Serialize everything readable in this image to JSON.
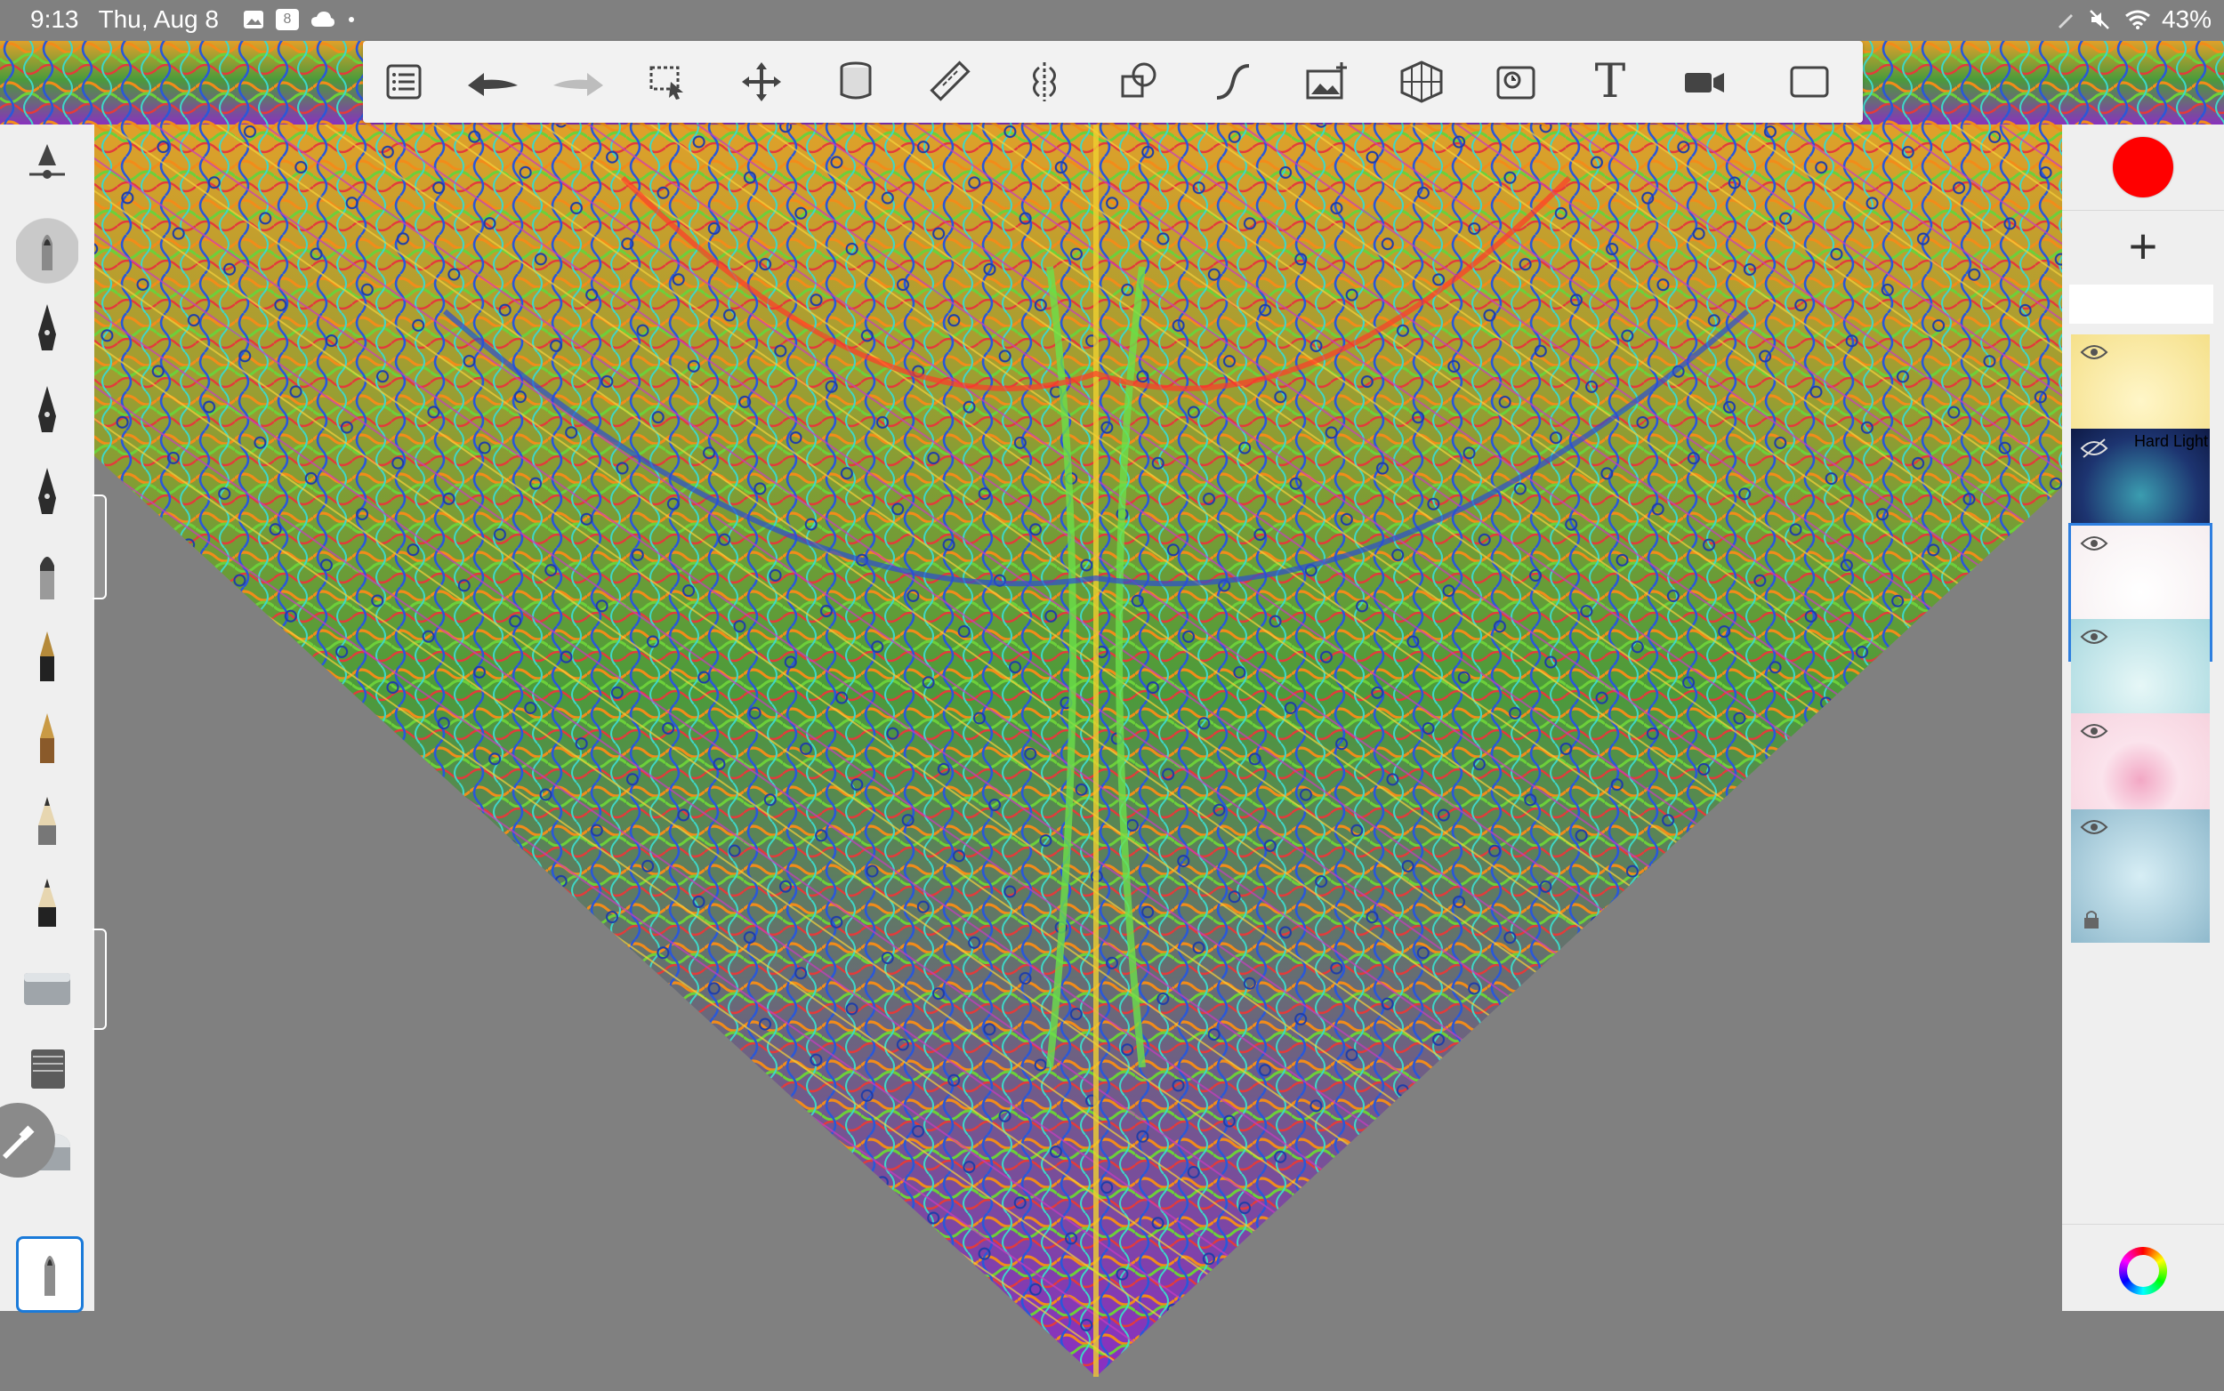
{
  "status_bar": {
    "time": "9:13",
    "date": "Thu, Aug 8",
    "calendar_day": "8",
    "battery": "43%",
    "left_icons": [
      "gallery-icon",
      "calendar-icon",
      "cloud-icon",
      "dot-icon"
    ],
    "right_icons": [
      "pen-icon",
      "mute-icon",
      "wifi-icon",
      "battery-icon"
    ]
  },
  "toolbar": {
    "tools": [
      {
        "name": "layers-list-button",
        "icon": "list-icon"
      },
      {
        "name": "undo-button",
        "icon": "undo-arrow-icon"
      },
      {
        "name": "redo-button",
        "icon": "redo-arrow-icon"
      },
      {
        "name": "selection-button",
        "icon": "selection-icon"
      },
      {
        "name": "transform-button",
        "icon": "move-icon"
      },
      {
        "name": "fill-button",
        "icon": "fill-bucket-icon"
      },
      {
        "name": "ruler-button",
        "icon": "ruler-icon"
      },
      {
        "name": "symmetry-button",
        "icon": "symmetry-icon"
      },
      {
        "name": "shapes-button",
        "icon": "shapes-icon"
      },
      {
        "name": "curve-button",
        "icon": "curve-icon"
      },
      {
        "name": "import-image-button",
        "icon": "image-add-icon"
      },
      {
        "name": "perspective-button",
        "icon": "perspective-grid-icon"
      },
      {
        "name": "timelapse-button",
        "icon": "timelapse-icon"
      },
      {
        "name": "text-button",
        "icon": "text-icon",
        "label": "T"
      },
      {
        "name": "record-button",
        "icon": "video-icon"
      },
      {
        "name": "fullscreen-button",
        "icon": "fullscreen-icon"
      }
    ]
  },
  "brushes": [
    {
      "name": "brush-settings",
      "icon": "brush-settings-icon"
    },
    {
      "name": "airbrush",
      "icon": "airbrush-icon"
    },
    {
      "name": "fine-pen",
      "icon": "pen-nib-icon"
    },
    {
      "name": "pen",
      "icon": "pen-nib-icon"
    },
    {
      "name": "ink-pen",
      "icon": "pen-nib-icon"
    },
    {
      "name": "marker",
      "icon": "marker-icon"
    },
    {
      "name": "fountain-pen",
      "icon": "fountain-pen-icon"
    },
    {
      "name": "calligraphy-pen",
      "icon": "calligraphy-pen-icon"
    },
    {
      "name": "pencil",
      "icon": "pencil-icon"
    },
    {
      "name": "graphite-pencil",
      "icon": "pencil-icon"
    },
    {
      "name": "eraser",
      "icon": "eraser-icon"
    },
    {
      "name": "smudge",
      "icon": "smudge-icon"
    },
    {
      "name": "blender",
      "icon": "blender-icon"
    },
    {
      "name": "active-brush",
      "icon": "brush-tip-icon"
    }
  ],
  "colors": {
    "current_color": "#ff0000",
    "active_outline": "#2e7fe0",
    "panel_bg": "#efefef",
    "canvas_bg": "#808080"
  },
  "layers": [
    {
      "name": "layer-1",
      "bg": "#f7e9a6",
      "blend_mode": "",
      "hidden": false
    },
    {
      "name": "layer-2",
      "bg": "#1d3470",
      "blend_mode": "Hard Light",
      "hidden": true
    },
    {
      "name": "layer-3",
      "bg": "#f7f1f3",
      "blend_mode": "",
      "hidden": false,
      "active": true
    },
    {
      "name": "layer-4",
      "bg": "#bfe6e8",
      "blend_mode": "",
      "hidden": false
    },
    {
      "name": "layer-5",
      "bg": "#f6d3de",
      "blend_mode": "",
      "hidden": false
    },
    {
      "name": "layer-6",
      "bg": "#9fc7d6",
      "blend_mode": "",
      "hidden": false
    }
  ],
  "add_layer_label": "+"
}
